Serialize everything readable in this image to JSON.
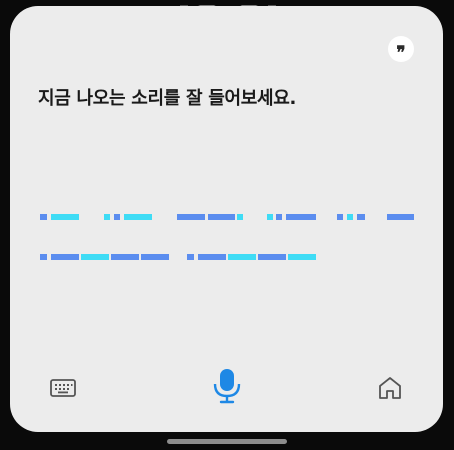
{
  "prompt": {
    "text": "지금 나오는 소리를 잘 들어보세요."
  },
  "quote_button": {
    "glyph": "❞",
    "icon": "quote-icon"
  },
  "bottom_bar": {
    "keyboard_icon": "keyboard-icon",
    "mic_icon": "microphone-icon",
    "home_icon": "home-icon"
  },
  "colors": {
    "card_background": "#ececec",
    "page_background": "#0a0a0a",
    "prompt_text": "#1a1a1a",
    "mic_accent": "#1e88e5",
    "morse_blue": "#5b8def",
    "morse_cyan": "#3fdcf5"
  }
}
